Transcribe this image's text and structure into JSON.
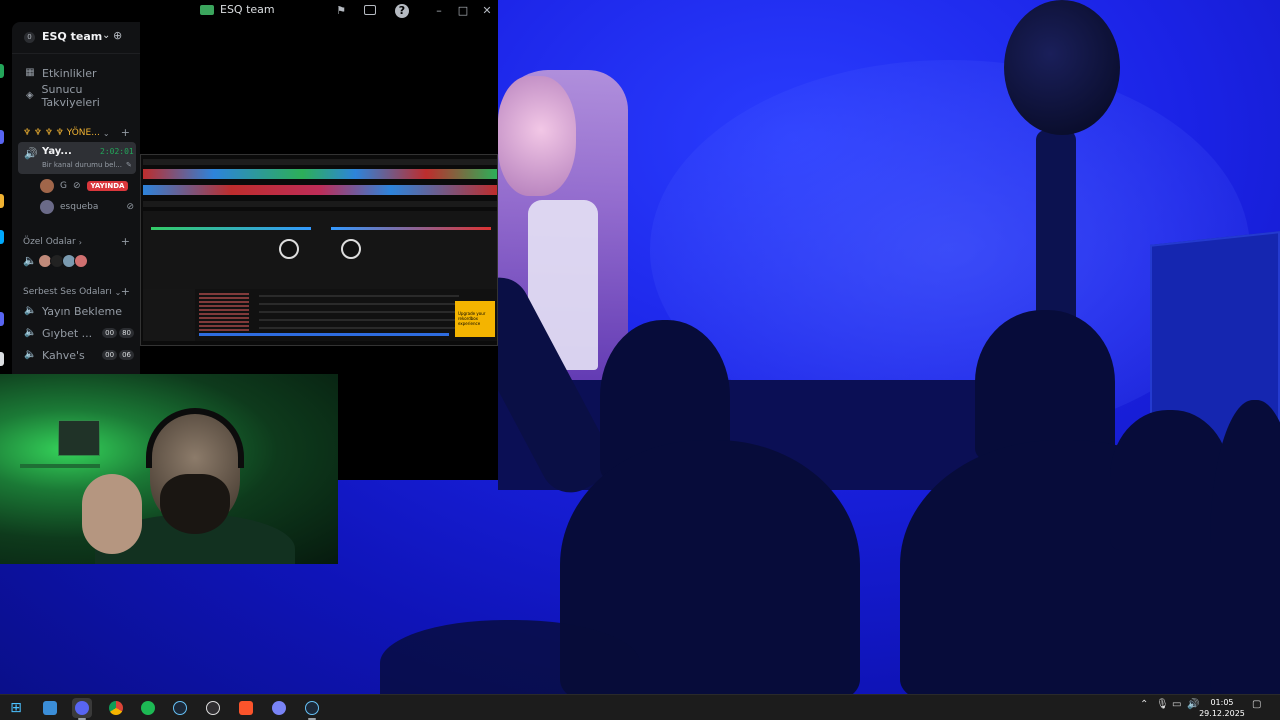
{
  "window": {
    "title": "ESQ team"
  },
  "server": {
    "badge": "0",
    "name": "ESQ team"
  },
  "nav": {
    "events": "Etkinlikler",
    "boosts": "Sunucu Takviyeleri"
  },
  "categories": {
    "admin": "♆ ♆ ♆ ♆ YÖNE...",
    "private": "Özel Odalar",
    "free_voice": "Serbest Ses Odaları"
  },
  "active_channel": {
    "name": "Yay...",
    "timer": "2:02:01",
    "status": "Bir kanal durumu bel..."
  },
  "members": [
    {
      "name": "G",
      "live": "YAYINDA"
    },
    {
      "name": "esqueba"
    }
  ],
  "voice_channels": [
    {
      "name": "Yayın Bekleme"
    },
    {
      "name": "Gıybet ...",
      "count": "00",
      "limit": "80"
    },
    {
      "name": "Kahve's",
      "count": "00",
      "limit": "06"
    }
  ],
  "stream": {
    "promo_text": "Upgrade your rekordbox experience"
  },
  "taskbar": {
    "apps": [
      "file-explorer",
      "discord",
      "chrome",
      "spotify",
      "steam",
      "obs",
      "brave",
      "discord-alt",
      "steam-alt"
    ],
    "clock_time": "01:05",
    "clock_date": "29.12.2025"
  },
  "colors": {
    "discord_bg": "#111214",
    "accent_green": "#23a55a",
    "live_red": "#da373c",
    "stage_blue": "#1b23e6"
  }
}
